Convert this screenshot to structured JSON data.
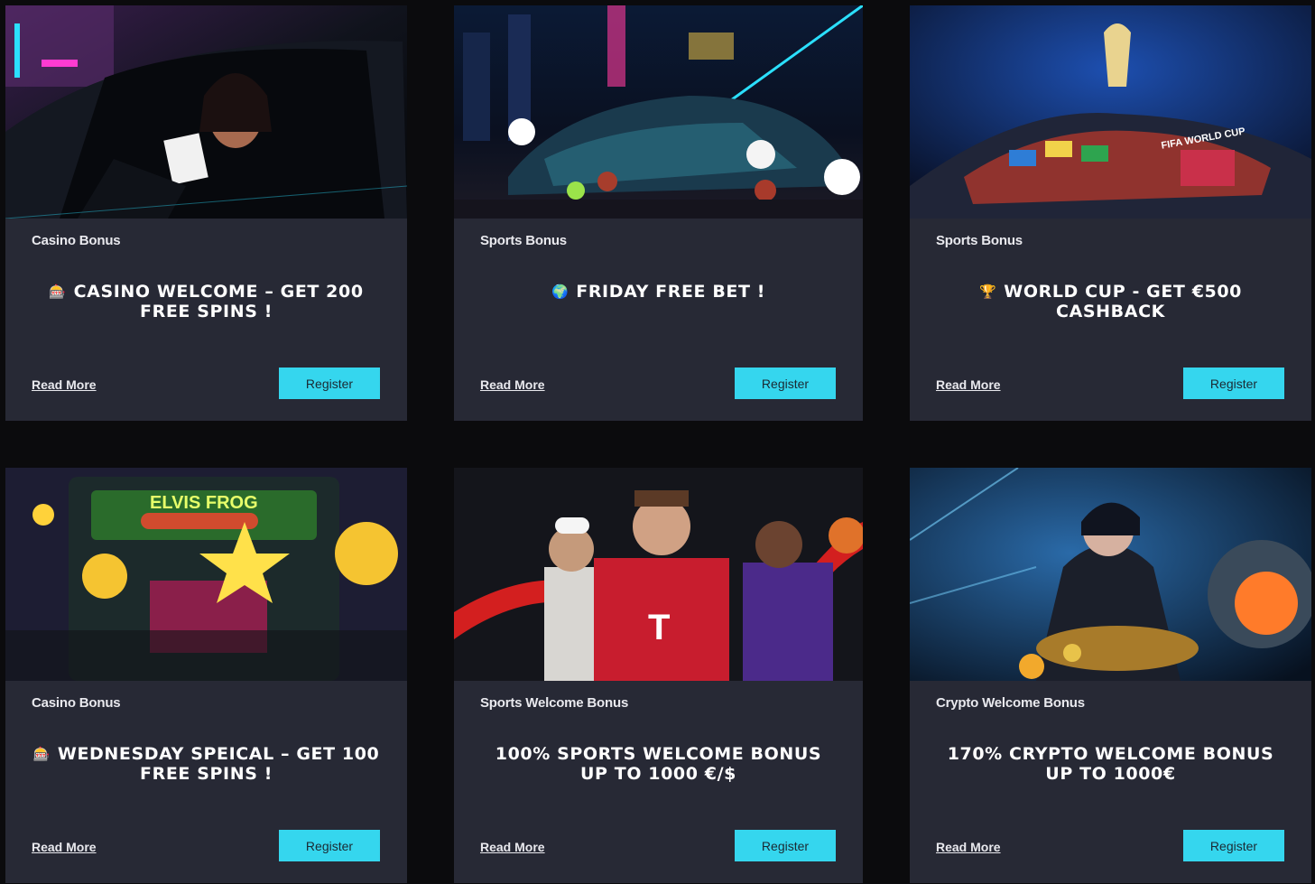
{
  "cards": [
    {
      "category": "Casino Bonus",
      "icon": "slot-machine-icon",
      "emoji": "🎰",
      "title": "Casino Welcome – Get 200 Free Spins !",
      "read_more": "Read More",
      "register": "Register",
      "image": "woman-in-car-with-cards"
    },
    {
      "category": "Sports Bonus",
      "icon": "globe-icon",
      "emoji": "🌍",
      "title": "Friday Free Bet !",
      "read_more": "Read More",
      "register": "Register",
      "image": "neon-car-with-balls"
    },
    {
      "category": "Sports Bonus",
      "icon": "trophy-icon",
      "emoji": "🏆",
      "title": "World Cup - Get €500 Cashback",
      "read_more": "Read More",
      "register": "Register",
      "image": "world-cup-stadium",
      "image_text": "FIFA WORLD CUP"
    },
    {
      "category": "Casino Bonus",
      "icon": "slot-machine-icon",
      "emoji": "🎰",
      "title": "Wednesday Speical – Get 100 Free Spins !",
      "read_more": "Read More",
      "register": "Register",
      "image": "elvis-frog-slot",
      "image_text": "ELVIS FROG"
    },
    {
      "category": "Sports Welcome Bonus",
      "title": "100% Sports Welcome Bonus up to 1000 €/$",
      "read_more": "Read More",
      "register": "Register",
      "image": "athletes-celebrating"
    },
    {
      "category": "Crypto Welcome Bonus",
      "title": "170% Crypto Welcome Bonus up to 1000€",
      "read_more": "Read More",
      "register": "Register",
      "image": "crypto-warrior-vault"
    }
  ],
  "colors": {
    "page_bg": "#0b0b0d",
    "card_bg": "#272935",
    "accent": "#35d6ee"
  }
}
